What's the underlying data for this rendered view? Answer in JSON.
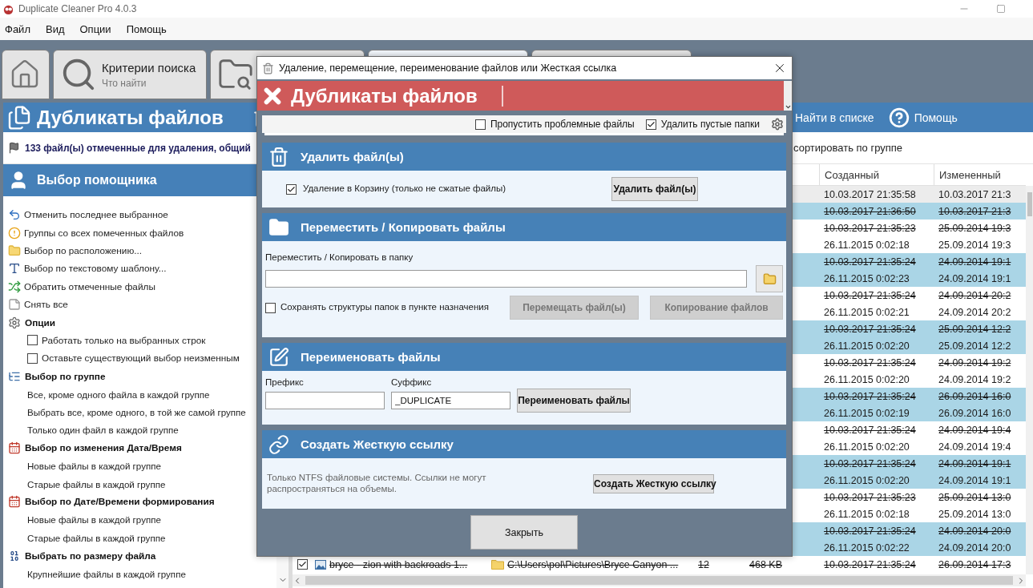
{
  "window": {
    "title": "Duplicate Cleaner Pro 4.0.3"
  },
  "menu": [
    "Файл",
    "Вид",
    "Опции",
    "Помощь"
  ],
  "tabs": [
    {
      "kind": "home",
      "selected": false
    },
    {
      "kind": "labeled",
      "label": "Критерии поиска",
      "sublabel": "Что найти",
      "selected": false
    },
    {
      "kind": "icon",
      "selected": false
    },
    {
      "kind": "blank",
      "selected": true
    },
    {
      "kind": "blank",
      "selected": false
    }
  ],
  "header": {
    "title": "Дубликаты файлов",
    "actions": [
      {
        "kind": "find",
        "label": "Найти в списке"
      },
      {
        "kind": "help",
        "label": "Помощь"
      }
    ]
  },
  "status": {
    "summary": "133 файл(ы) отмеченные для удаления, общий",
    "sort_label": "сортировать по группе"
  },
  "assistant": {
    "title": "Выбор помощника",
    "items": [
      {
        "kind": "action",
        "label": "Отменить последнее выбранное"
      },
      {
        "kind": "action",
        "label": "Группы со всех помеченных файлов"
      },
      {
        "kind": "action",
        "label": "Выбор по расположению..."
      },
      {
        "kind": "action",
        "label": "Выбор по текстовому шаблону..."
      },
      {
        "kind": "action",
        "label": "Обратить отмеченные файлы"
      },
      {
        "kind": "action",
        "label": "Снять все"
      },
      {
        "kind": "header",
        "label": "Опции"
      },
      {
        "kind": "checkbox",
        "label": "Работать только на выбранных строк",
        "checked": false
      },
      {
        "kind": "checkbox",
        "label": "Оставьте существующий выбор неизменным",
        "checked": false
      },
      {
        "kind": "header",
        "label": "Выбор по группе"
      },
      {
        "kind": "option",
        "label": "Все, кроме одного файла в каждой группе"
      },
      {
        "kind": "option",
        "label": "Выбрать все, кроме одного, в той же самой группе"
      },
      {
        "kind": "option",
        "label": "Только один файл в каждой группе"
      },
      {
        "kind": "header",
        "label": "Выбор по изменения Дата/Время"
      },
      {
        "kind": "option",
        "label": "Новые файлы в каждой группе"
      },
      {
        "kind": "option",
        "label": "Старые файлы в каждой группе"
      },
      {
        "kind": "header",
        "label": "Выбор по Дате/Времени формирования"
      },
      {
        "kind": "option",
        "label": "Новые файлы в каждой группе"
      },
      {
        "kind": "option",
        "label": "Старые файлы в каждой группе"
      },
      {
        "kind": "header",
        "label": "Выбрать по размеру файла"
      },
      {
        "kind": "option",
        "label": "Крупнейшие файлы в каждой группе"
      }
    ]
  },
  "table": {
    "columns": [
      "Созданный",
      "Измененный"
    ],
    "rows": [
      {
        "created": "10.03.2017 21:35:58",
        "modified": "10.03.2017 21:3",
        "marked": false,
        "highlighted": false,
        "selected": true
      },
      {
        "created": "10.03.2017 21:36:50",
        "modified": "10.03.2017 21:3",
        "marked": true,
        "highlighted": true,
        "selected": false
      },
      {
        "created": "10.03.2017 21:35:23",
        "modified": "25.09.2014 19:3",
        "marked": true,
        "highlighted": false,
        "selected": false
      },
      {
        "created": "26.11.2015 0:02:18",
        "modified": "25.09.2014 19:3",
        "marked": false,
        "highlighted": false,
        "selected": false
      },
      {
        "created": "10.03.2017 21:35:24",
        "modified": "24.09.2014 19:1",
        "marked": true,
        "highlighted": true,
        "selected": false
      },
      {
        "created": "26.11.2015 0:02:23",
        "modified": "24.09.2014 19:1",
        "marked": false,
        "highlighted": true,
        "selected": false
      },
      {
        "created": "10.03.2017 21:35:24",
        "modified": "24.09.2014 20:2",
        "marked": true,
        "highlighted": false,
        "selected": false
      },
      {
        "created": "26.11.2015 0:02:21",
        "modified": "24.09.2014 20:2",
        "marked": false,
        "highlighted": false,
        "selected": false
      },
      {
        "created": "10.03.2017 21:35:24",
        "modified": "25.09.2014 12:2",
        "marked": true,
        "highlighted": true,
        "selected": false
      },
      {
        "created": "26.11.2015 0:02:20",
        "modified": "25.09.2014 12:2",
        "marked": false,
        "highlighted": true,
        "selected": false
      },
      {
        "created": "10.03.2017 21:35:24",
        "modified": "24.09.2014 19:2",
        "marked": true,
        "highlighted": false,
        "selected": false
      },
      {
        "created": "26.11.2015 0:02:20",
        "modified": "24.09.2014 19:2",
        "marked": false,
        "highlighted": false,
        "selected": false
      },
      {
        "created": "10.03.2017 21:35:24",
        "modified": "26.09.2014 16:0",
        "marked": true,
        "highlighted": true,
        "selected": false
      },
      {
        "created": "26.11.2015 0:02:19",
        "modified": "26.09.2014 16:0",
        "marked": false,
        "highlighted": true,
        "selected": false
      },
      {
        "created": "10.03.2017 21:35:24",
        "modified": "24.09.2014 19:4",
        "marked": true,
        "highlighted": false,
        "selected": false
      },
      {
        "created": "26.11.2015 0:02:20",
        "modified": "24.09.2014 19:4",
        "marked": false,
        "highlighted": false,
        "selected": false
      },
      {
        "created": "10.03.2017 21:35:24",
        "modified": "24.09.2014 19:1",
        "marked": true,
        "highlighted": true,
        "selected": false
      },
      {
        "created": "26.11.2015 0:02:20",
        "modified": "24.09.2014 19:1",
        "marked": false,
        "highlighted": true,
        "selected": false
      },
      {
        "created": "10.03.2017 21:35:23",
        "modified": "25.09.2014 13:0",
        "marked": true,
        "highlighted": false,
        "selected": false
      },
      {
        "created": "26.11.2015 0:02:18",
        "modified": "25.09.2014 13:0",
        "marked": false,
        "highlighted": false,
        "selected": false
      },
      {
        "created": "10.03.2017 21:35:24",
        "modified": "24.09.2014 20:0",
        "marked": true,
        "highlighted": true,
        "selected": false
      },
      {
        "created": "26.11.2015 0:02:22",
        "modified": "24.09.2014 20:0",
        "marked": false,
        "highlighted": true,
        "selected": false
      },
      {
        "checked": true,
        "column_2": "bryce - zion with backroads 1...",
        "column_3": "C:\\Users\\pol\\Pictures\\Bryce Canyon ...",
        "column_4": "12",
        "column_5": "468 KB",
        "created": "10.03.2017 21:35:24",
        "modified": "26.09.2014 17:3",
        "marked": true,
        "highlighted": false,
        "selected": false
      }
    ]
  },
  "dialog": {
    "title": "Удаление, перемещение, переименование файлов или Жесткая ссылка",
    "banner": "Дубликаты файлов",
    "options": [
      {
        "label": "Пропустить проблемные файлы",
        "checked": false
      },
      {
        "label": "Удалить пустые папки",
        "checked": true
      }
    ],
    "sections": [
      {
        "kind": "delete",
        "title": "Удалить файл(ы)",
        "checkbox": {
          "label": "Удаление в Корзину (только не сжатые файлы)",
          "checked": true
        },
        "button": "Удалить файл(ы)"
      },
      {
        "kind": "move",
        "title": "Переместить / Копировать файлы",
        "field_label": "Переместить / Копировать в папку",
        "checkbox": {
          "label": "Сохранять структуры папок в пункте назначения",
          "checked": false
        },
        "buttons": [
          {
            "label": "Перемещать файл(ы)",
            "disabled": true
          },
          {
            "label": "Копирование файлов",
            "disabled": true
          }
        ]
      },
      {
        "kind": "rename",
        "title": "Переименовать файлы",
        "prefix_label": "Префикс",
        "suffix_label": "Суффикс",
        "suffix_value": "_DUPLICATE",
        "button": "Переименовать файлы"
      },
      {
        "kind": "link",
        "title": "Создать Жесткую ссылку",
        "note": "Только NTFS файловые системы. Ссылки не могут распространяться на объемы.",
        "button": "Создать Жесткую ссылку"
      }
    ],
    "close": "Закрыть"
  }
}
